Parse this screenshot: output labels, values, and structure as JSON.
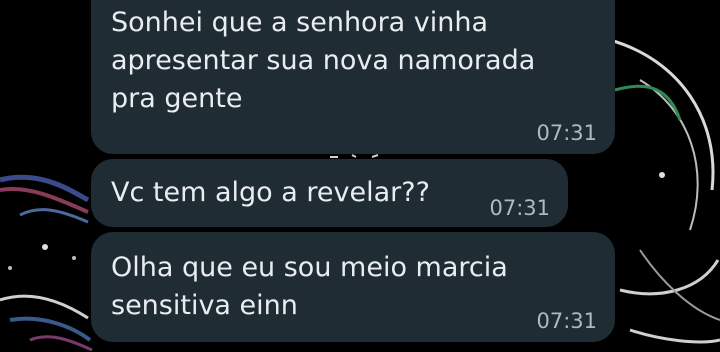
{
  "chat": {
    "messages": [
      {
        "text": "Sonhei que a senhora vinha\napresentar sua nova namorada\npra gente",
        "time": "07:31"
      },
      {
        "text": "Vc tem algo a revelar??",
        "time": "07:31"
      },
      {
        "text": "Olha que eu sou meio marcia\nsensitiva einn",
        "time": "07:31"
      }
    ]
  },
  "colors": {
    "background": "#000000",
    "bubble": "#1f2c34",
    "text": "#e9edef",
    "timestamp": "#aebac1",
    "accent": "#25d366"
  }
}
